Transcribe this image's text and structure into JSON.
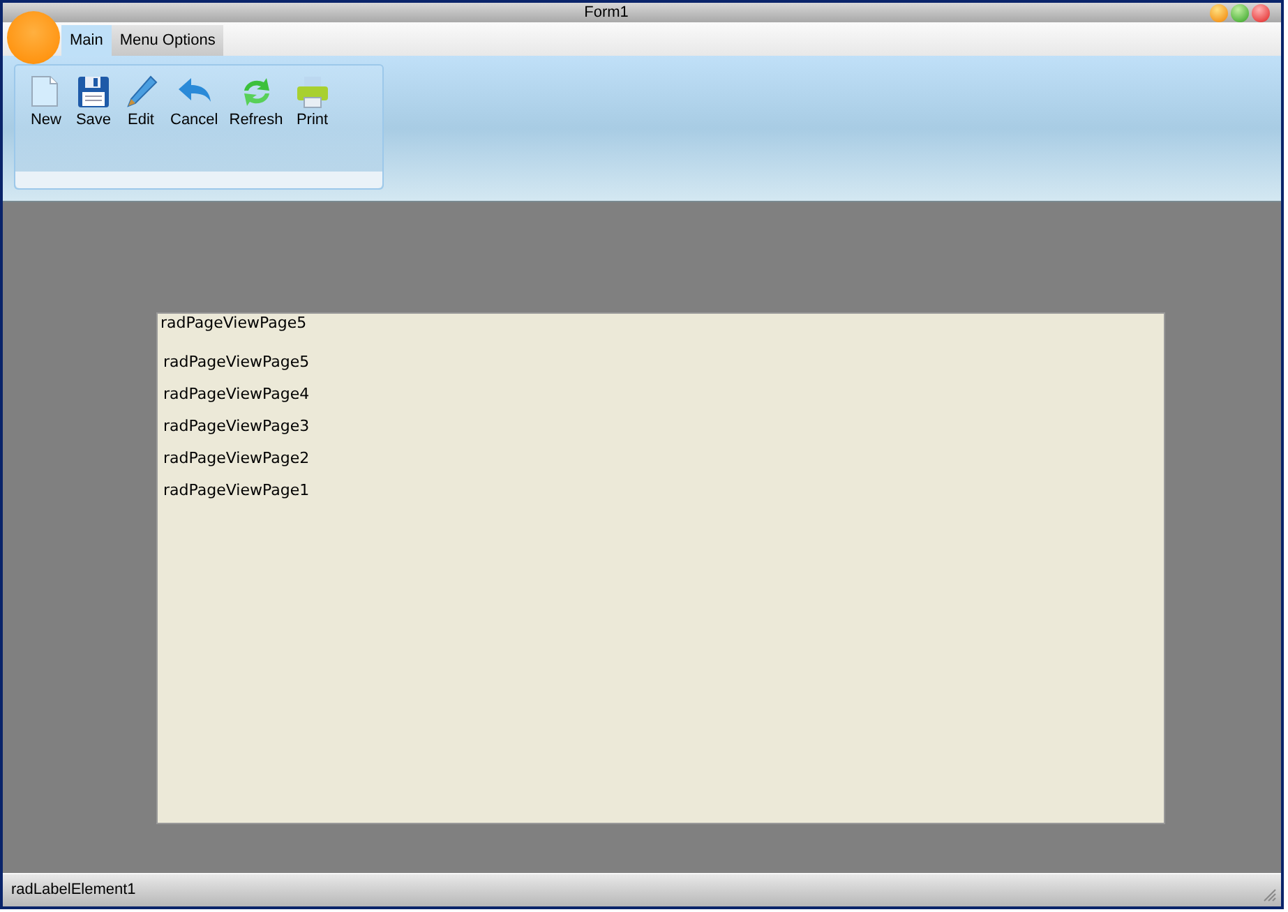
{
  "window": {
    "title": "Form1"
  },
  "tabs": [
    {
      "label": "Main",
      "selected": true
    },
    {
      "label": "Menu Options",
      "selected": false
    }
  ],
  "toolbar": [
    {
      "label": "New",
      "kind": "new"
    },
    {
      "label": "Save",
      "kind": "save"
    },
    {
      "label": "Edit",
      "kind": "edit"
    },
    {
      "label": "Cancel",
      "kind": "cancel"
    },
    {
      "label": "Refresh",
      "kind": "refresh"
    },
    {
      "label": "Print",
      "kind": "print"
    }
  ],
  "page_view": {
    "header": "radPageViewPage5",
    "items": [
      "radPageViewPage5",
      "radPageViewPage4",
      "radPageViewPage3",
      "radPageViewPage2",
      "radPageViewPage1"
    ]
  },
  "status_bar": {
    "label": "radLabelElement1"
  }
}
